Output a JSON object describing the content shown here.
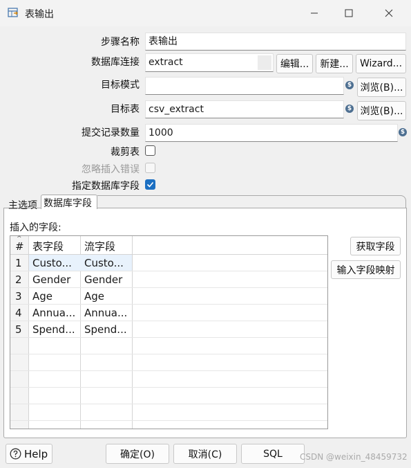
{
  "window": {
    "title": "表输出"
  },
  "form": {
    "step_name_label": "步骤名称",
    "step_name_value": "表输出",
    "db_conn_label": "数据库连接",
    "db_conn_value": "extract",
    "edit_button": "编辑...",
    "new_button": "新建...",
    "wizard_button": "Wizard...",
    "target_schema_label": "目标模式",
    "target_schema_value": "",
    "browse_button": "浏览(B)...",
    "target_table_label": "目标表",
    "target_table_value": "csv_extract",
    "commit_size_label": "提交记录数量",
    "commit_size_value": "1000",
    "truncate_label": "裁剪表",
    "truncate_checked": false,
    "ignore_errors_label": "忽略插入错误",
    "ignore_errors_checked": false,
    "specify_fields_label": "指定数据库字段",
    "specify_fields_checked": true
  },
  "tabs": [
    {
      "label": "主选项",
      "active": false
    },
    {
      "label": "数据库字段",
      "active": true
    }
  ],
  "fields_panel": {
    "title": "插入的字段:",
    "columns": [
      "#",
      "表字段",
      "流字段"
    ],
    "rows": [
      {
        "num": "1",
        "table_field": "Custo...",
        "stream_field": "Custo..."
      },
      {
        "num": "2",
        "table_field": "Gender",
        "stream_field": "Gender"
      },
      {
        "num": "3",
        "table_field": "Age",
        "stream_field": "Age"
      },
      {
        "num": "4",
        "table_field": "Annua...",
        "stream_field": "Annua..."
      },
      {
        "num": "5",
        "table_field": "Spend...",
        "stream_field": "Spend..."
      }
    ],
    "get_fields_button": "获取字段",
    "mapping_button": "输入字段映射"
  },
  "footer": {
    "help_button": "Help",
    "ok_button": "确定(O)",
    "cancel_button": "取消(C)",
    "sql_button": "SQL"
  },
  "watermark": "CSDN @weixin_48459732",
  "colors": {
    "accent": "#1b6fc2",
    "variable_icon": "#4d6f91",
    "selected_row": "#e8f2fc"
  }
}
